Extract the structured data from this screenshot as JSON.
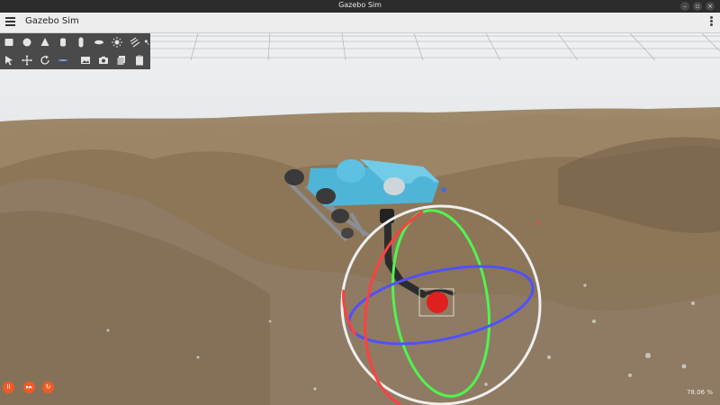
{
  "window": {
    "title": "Gazebo Sim"
  },
  "appbar": {
    "title": "Gazebo Sim"
  },
  "toolbar": {
    "row1": [
      "box-icon",
      "sphere-icon",
      "cone-icon",
      "cylinder-icon",
      "capsule-icon",
      "ellipsoid-icon",
      "sun-light-icon",
      "directional-light-icon",
      "spot-light-icon"
    ],
    "row2": [
      "select-icon",
      "translate-icon",
      "rotate-icon",
      "transform-link-icon",
      "screenshot-icon",
      "camera-icon",
      "copy-icon",
      "paste-icon"
    ]
  },
  "controls": {
    "play": "II",
    "step": "▸▸",
    "reset": "↻"
  },
  "status": {
    "rtf": "78.06 %"
  },
  "colors": {
    "toolbar_bg": "#4a4a4a",
    "accent": "#f15a24",
    "sky": "#d8dadd",
    "ground": "#8a7457"
  }
}
